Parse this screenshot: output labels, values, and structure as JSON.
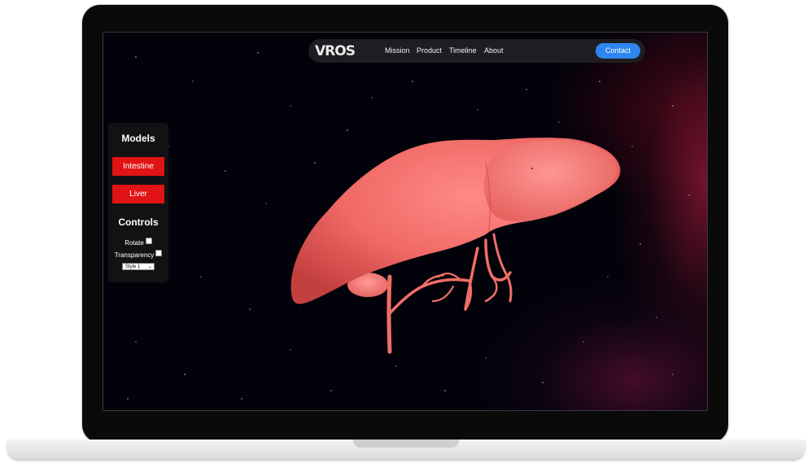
{
  "nav": {
    "logo": "VROS",
    "links": [
      "Mission",
      "Product",
      "Timeline",
      "About"
    ],
    "contact_label": "Contact"
  },
  "panel": {
    "models_heading": "Models",
    "model_buttons": [
      "Intestine",
      "Liver"
    ],
    "controls_heading": "Controls",
    "rotate_label": "Rotate",
    "transparency_label": "Transparency",
    "style_select_value": "Style 1"
  },
  "colors": {
    "accent_button": "#e01414",
    "contact_button": "#2e86f0",
    "organ": "#f06a66"
  },
  "icons": {
    "select_chevron": "chevron-down-icon"
  }
}
